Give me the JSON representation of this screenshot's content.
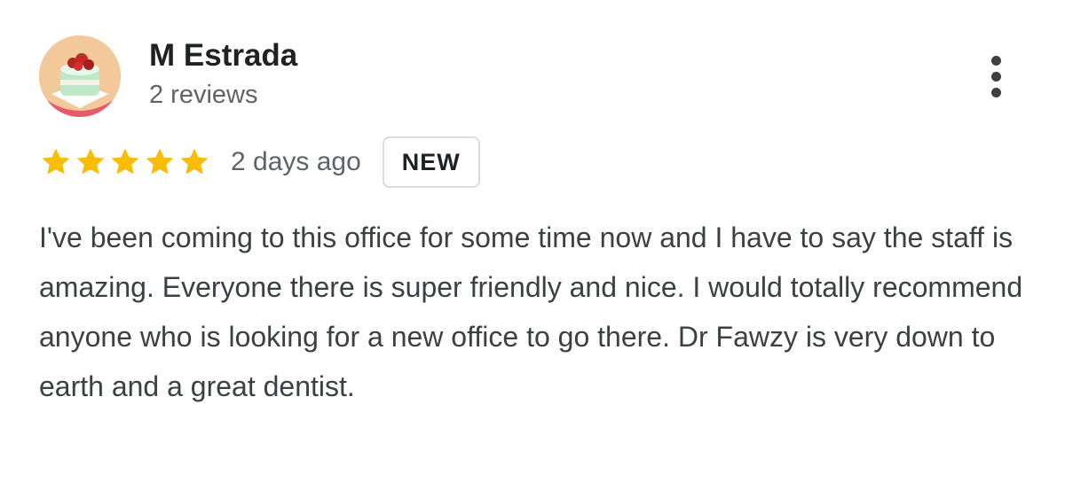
{
  "review": {
    "author_name": "M Estrada",
    "review_count": "2 reviews",
    "rating": 5,
    "rating_max": 5,
    "date": "2 days ago",
    "badge": "NEW",
    "text": "I've been coming to this office for some time now and I have to say the staff is amazing. Everyone there is super friendly and nice. I would totally recommend anyone who is looking for a new office to go there. Dr Fawzy is very down to earth and a great dentist."
  },
  "icons": {
    "avatar": "cake-avatar-icon",
    "more": "more-vert-icon",
    "star": "star-icon"
  },
  "colors": {
    "star": "#fbbc04",
    "name": "#202124",
    "secondary_text": "#5f6368",
    "body_text": "#3c4043",
    "badge_border": "#dadce0"
  }
}
